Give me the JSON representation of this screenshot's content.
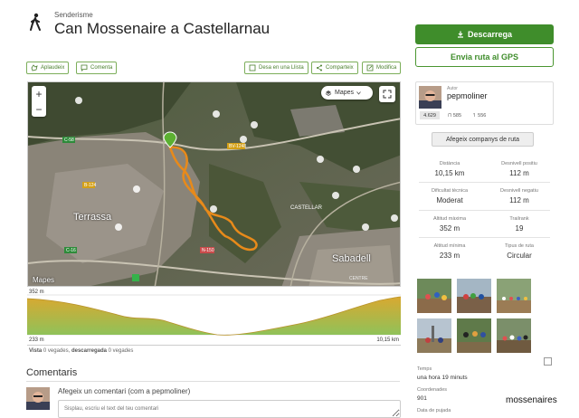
{
  "header": {
    "category": "Senderisme",
    "title": "Can Mossenaire a Castellarnau"
  },
  "actions": {
    "applaud": "Aplaudeix",
    "comment": "Comenta",
    "save_list": "Desa en una Llista",
    "share": "Comparteix",
    "edit": "Modifica"
  },
  "sidebar_buttons": {
    "download": "Descarrega",
    "send_gps": "Envia ruta al GPS"
  },
  "map": {
    "layers_label": "Mapes",
    "zoom_in": "+",
    "zoom_out": "−",
    "labels": {
      "terrassa": "Terrassa",
      "sabadell": "Sabadell",
      "apple_maps": "Mapes",
      "road_1": "C-58",
      "road_2": "BV-1248",
      "road_3": "B-124",
      "road_4": "C-16",
      "road_5": "N-150",
      "castellar": "CASTELLAR",
      "centre": "CENTRE"
    }
  },
  "elevation": {
    "max_label": "352 m",
    "min_label": "233 m",
    "distance_label": "10,15 km"
  },
  "stats_line": {
    "views_label": "Vista",
    "views_value": "0 vegades",
    "downloads_label": "descarregada",
    "downloads_value": "0 vegades"
  },
  "comments": {
    "title": "Comentaris",
    "prompt": "Afegeix un comentari (com a pepmoliner)",
    "placeholder": "Sisplau, escriu el text del teu comentari"
  },
  "author": {
    "label": "Autor",
    "name": "pepmoliner",
    "rank": "4.629",
    "trails": "585",
    "followers": "556"
  },
  "companions_button": "Afegeix companys de ruta",
  "details": [
    {
      "label": "Distància",
      "value": "10,15 km"
    },
    {
      "label": "Desnivell positiu",
      "value": "112 m"
    },
    {
      "label": "Dificultat tècnica",
      "value": "Moderat"
    },
    {
      "label": "Desnivell negatiu",
      "value": "112 m"
    },
    {
      "label": "Altitud màxima",
      "value": "352 m"
    },
    {
      "label": "Trailrank",
      "value": "19"
    },
    {
      "label": "Altitud mínima",
      "value": "233 m"
    },
    {
      "label": "Tipus de ruta",
      "value": "Circular"
    }
  ],
  "info": {
    "time_label": "Temps",
    "time_value": "una hora 19 minuts",
    "coords_label": "Coordenades",
    "coords_value": "901",
    "date_label": "Data de pujada"
  },
  "watermark": "mossenaires",
  "colors": {
    "accent_green": "#3f8d2b",
    "route_orange": "#e88a1a",
    "elevation_fill": "#c7b24a"
  }
}
